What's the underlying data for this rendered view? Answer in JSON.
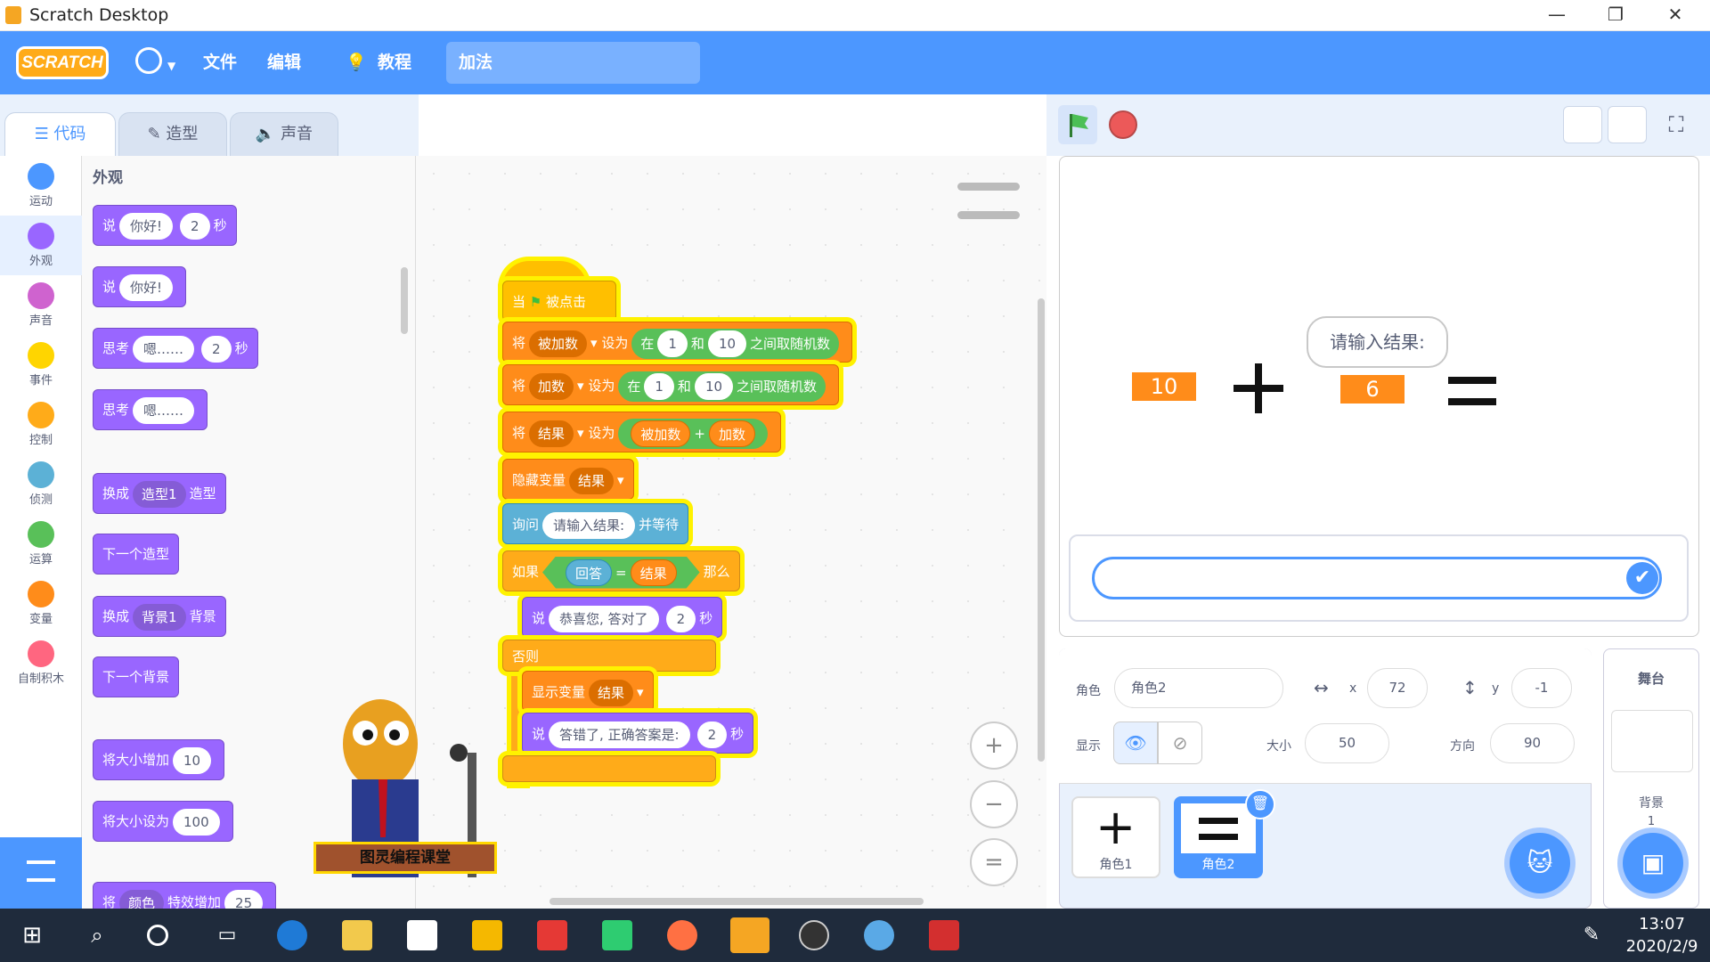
{
  "window": {
    "title": "Scratch Desktop",
    "controls": [
      "—",
      "❐",
      "✕"
    ]
  },
  "menu": {
    "logo": "SCRATCH",
    "file": "文件",
    "edit": "编辑",
    "tutorials": "教程",
    "project_title": "加法"
  },
  "tabs": [
    {
      "label": "代码"
    },
    {
      "label": "造型"
    },
    {
      "label": "声音"
    }
  ],
  "categories": [
    {
      "label": "运动",
      "color": "#4c97ff"
    },
    {
      "label": "外观",
      "color": "#9966ff"
    },
    {
      "label": "声音",
      "color": "#cf63cf"
    },
    {
      "label": "事件",
      "color": "#ffd500"
    },
    {
      "label": "控制",
      "color": "#ffab19"
    },
    {
      "label": "侦测",
      "color": "#5cb1d6"
    },
    {
      "label": "运算",
      "color": "#59c059"
    },
    {
      "label": "变量",
      "color": "#ff8c1a"
    },
    {
      "label": "自制积木",
      "color": "#ff6680"
    }
  ],
  "palette": {
    "title": "外观",
    "say_secs": {
      "say": "说",
      "text": "你好!",
      "secs": "2",
      "unit": "秒"
    },
    "say": {
      "say": "说",
      "text": "你好!"
    },
    "think_secs": {
      "think": "思考",
      "text": "嗯……",
      "secs": "2",
      "unit": "秒"
    },
    "think": {
      "think": "思考",
      "text": "嗯……"
    },
    "switch_costume": {
      "a": "换成",
      "v": "造型1",
      "b": "造型"
    },
    "next_costume": "下一个造型",
    "switch_backdrop": {
      "a": "换成",
      "v": "背景1",
      "b": "背景"
    },
    "next_backdrop": "下一个背景",
    "change_size": {
      "a": "将大小增加",
      "v": "10"
    },
    "set_size": {
      "a": "将大小设为",
      "v": "100"
    },
    "partial": {
      "a": "将",
      "v": "颜色",
      "b": "特效增加",
      "c": "25"
    }
  },
  "script": {
    "hat": {
      "when": "当",
      "clicked": "被点击"
    },
    "set1": {
      "set": "将",
      "var": "被加数",
      "to": "设为",
      "in": "在",
      "from": "1",
      "and": "和",
      "to_n": "10",
      "rand": "之间取随机数"
    },
    "set2": {
      "set": "将",
      "var": "加数",
      "to": "设为",
      "in": "在",
      "from": "1",
      "and": "和",
      "to_n": "10",
      "rand": "之间取随机数"
    },
    "set3": {
      "set": "将",
      "var": "结果",
      "to": "设为",
      "a": "被加数",
      "op": "+",
      "b": "加数"
    },
    "hide": {
      "label": "隐藏变量",
      "var": "结果"
    },
    "ask": {
      "label": "询问",
      "q": "请输入结果:",
      "wait": "并等待"
    },
    "if": {
      "if": "如果",
      "answer": "回答",
      "eq": "=",
      "var": "结果",
      "then": "那么",
      "else": "否则"
    },
    "say_ok": {
      "say": "说",
      "text": "恭喜您, 答对了",
      "secs": "2",
      "unit": "秒"
    },
    "show": {
      "label": "显示变量",
      "var": "结果"
    },
    "say_no": {
      "say": "说",
      "text": "答错了, 正确答案是:",
      "secs": "2",
      "unit": "秒"
    }
  },
  "mascot_banner": "图灵编程课堂",
  "zoom": {
    "in": "+",
    "out": "−",
    "reset": "="
  },
  "stage": {
    "mon_a": "10",
    "mon_b": "6",
    "bubble": "请输入结果:"
  },
  "sprite_info": {
    "sprite_label": "角色",
    "sprite_name": "角色2",
    "x_label": "x",
    "x": "72",
    "y_label": "y",
    "y": "-1",
    "show_label": "显示",
    "size_label": "大小",
    "size": "50",
    "dir_label": "方向",
    "dir": "90"
  },
  "sprites": [
    {
      "name": "角色1"
    },
    {
      "name": "角色2"
    }
  ],
  "stage_pane": {
    "title": "舞台",
    "backdrops": "背景",
    "count": "1"
  },
  "taskbar": {
    "time": "13:07",
    "date": "2020/2/9"
  }
}
